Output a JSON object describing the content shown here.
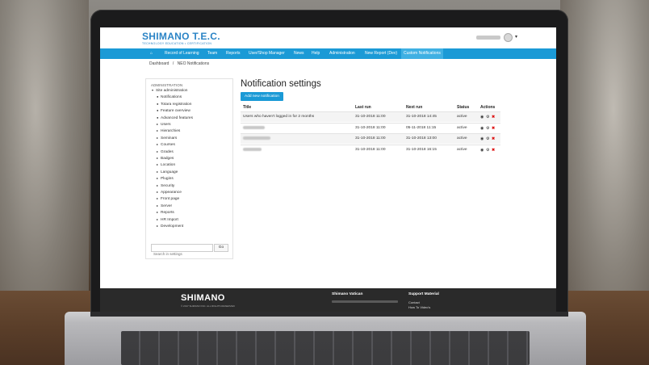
{
  "site": {
    "logo_text": "SHIMANO T.E.C.",
    "logo_subtitle": "TECHNOLOGY EDUCATION • CERTIFICATION"
  },
  "nav": {
    "home_icon": "home-icon",
    "items": [
      {
        "label": "Record of Learning"
      },
      {
        "label": "Team"
      },
      {
        "label": "Reports"
      },
      {
        "label": "User/Shop Manager"
      },
      {
        "label": "News"
      },
      {
        "label": "Help"
      },
      {
        "label": "Administration"
      },
      {
        "label": "New Report (Dev)"
      },
      {
        "label": "Custom Notifications"
      }
    ]
  },
  "breadcrumb": {
    "items": [
      "Dashboard",
      "/",
      "NEO Notifications"
    ]
  },
  "admin_block": {
    "title": "ADMINISTRATION",
    "tree": [
      {
        "label": "Site administration",
        "glyph": "▾"
      },
      {
        "label": "Notifications",
        "glyph": "●"
      },
      {
        "label": "Totara registration",
        "glyph": "●"
      },
      {
        "label": "Feature overview",
        "glyph": "●"
      },
      {
        "label": "Advanced features",
        "glyph": "●"
      },
      {
        "label": "Users",
        "glyph": "▸"
      },
      {
        "label": "Hierarchies",
        "glyph": "▸"
      },
      {
        "label": "Seminars",
        "glyph": "▸"
      },
      {
        "label": "Courses",
        "glyph": "▸"
      },
      {
        "label": "Grades",
        "glyph": "▸"
      },
      {
        "label": "Badges",
        "glyph": "▸"
      },
      {
        "label": "Location",
        "glyph": "▸"
      },
      {
        "label": "Language",
        "glyph": "▸"
      },
      {
        "label": "Plugins",
        "glyph": "▸"
      },
      {
        "label": "Security",
        "glyph": "▸"
      },
      {
        "label": "Appearance",
        "glyph": "▸"
      },
      {
        "label": "Front page",
        "glyph": "▸"
      },
      {
        "label": "Server",
        "glyph": "▸"
      },
      {
        "label": "Reports",
        "glyph": "▸"
      },
      {
        "label": "HR Import",
        "glyph": "▸"
      },
      {
        "label": "Development",
        "glyph": "▸"
      }
    ],
    "search_placeholder": "Search in settings",
    "go_label": "Go"
  },
  "main": {
    "title": "Notification settings",
    "add_button": "Add new notification",
    "columns": [
      "Title",
      "Last run",
      "Next run",
      "Status",
      "Actions"
    ],
    "rows": [
      {
        "title": "Users who haven't logged in for 2 months",
        "last_run": "31-10-2018 11:00",
        "next_run": "31-10-2018 14:45",
        "status": "active",
        "title_blurred": false
      },
      {
        "title": "",
        "last_run": "31-10-2018 11:00",
        "next_run": "05-11-2018 11:15",
        "status": "active",
        "title_blurred": true
      },
      {
        "title": "",
        "last_run": "31-10-2018 11:00",
        "next_run": "31-10-2018 13:00",
        "status": "active",
        "title_blurred": true
      },
      {
        "title": "",
        "last_run": "31-10-2018 11:00",
        "next_run": "31-10-2018 16:15",
        "status": "active",
        "title_blurred": true
      }
    ],
    "action_icons": {
      "view": "◉",
      "settings": "⚙",
      "delete": "✖"
    }
  },
  "footer": {
    "logo": "SHIMANO",
    "copyright": "© 2017 SHIMANO INC. ALL RIGHTS RESERVED",
    "col1_title": "Shimano Vatican",
    "col2_title": "Support Material",
    "col2_links": [
      "Contact",
      "How To Video's"
    ]
  },
  "colors": {
    "brand_blue": "#1b9ad6",
    "active_tab": "#3fb0e3",
    "footer_bg": "#2a2a2a",
    "delete_red": "#dd1111"
  }
}
